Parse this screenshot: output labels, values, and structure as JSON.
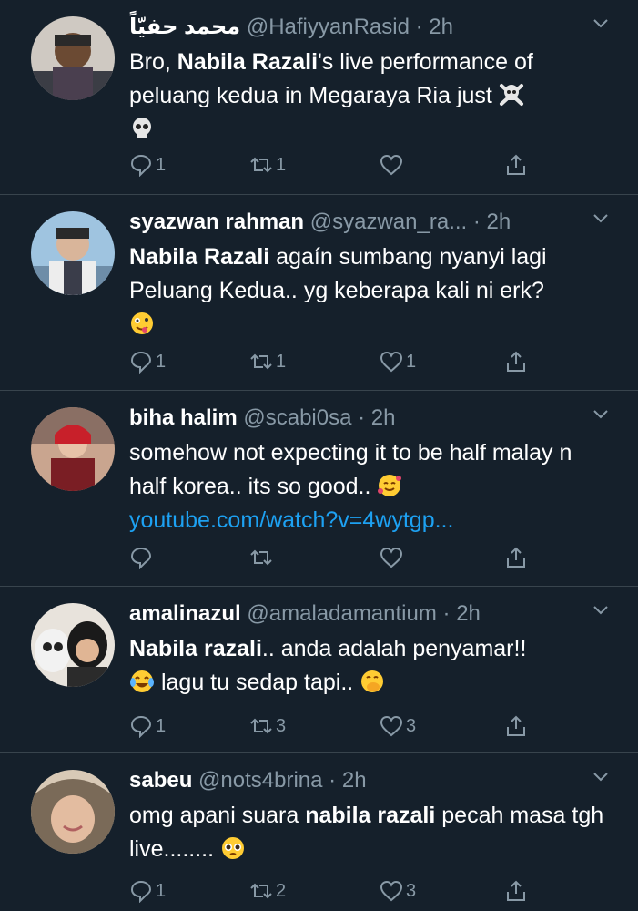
{
  "theme": {
    "background": "#15202b",
    "divider": "#38444d",
    "muted": "#8899a6",
    "link": "#1da1f2"
  },
  "tweets": [
    {
      "name": "محمد حفيّاً",
      "handle": "@HafiyyanRasid",
      "sep": "·",
      "time": "2h",
      "segments": [
        {
          "t": "Bro, ",
          "bold": false
        },
        {
          "t": "Nabila Razali",
          "bold": true
        },
        {
          "t": "'s live performance of peluang kedua in Megaraya Ria just ",
          "bold": false
        }
      ],
      "emojis": [
        "skull-crossbones-emoji",
        "skull-emoji"
      ],
      "replies": "1",
      "retweets": "1",
      "likes": ""
    },
    {
      "name": "syazwan rahman",
      "handle": "@syazwan_ra...",
      "sep": "·",
      "time": "2h",
      "segments": [
        {
          "t": "Nabila Razali",
          "bold": true
        },
        {
          "t": " agaín sumbang nyanyi lagi Peluang Kedua.. yg keberapa kali ni erk?",
          "bold": false
        }
      ],
      "emojis": [
        "zany-face-emoji"
      ],
      "replies": "1",
      "retweets": "1",
      "likes": "1"
    },
    {
      "name": "biha halim",
      "handle": "@scabi0sa",
      "sep": "·",
      "time": "2h",
      "segments": [
        {
          "t": "somehow not expecting it to be half malay n half korea.. its so good.. ",
          "bold": false
        }
      ],
      "emojis": [
        "smiling-face-with-hearts-emoji"
      ],
      "link": "youtube.com/watch?v=4wytgp...",
      "replies": "",
      "retweets": "",
      "likes": ""
    },
    {
      "name": "amalinazul",
      "handle": "@amaladamantium",
      "sep": "·",
      "time": "2h",
      "segments": [
        {
          "t": "Nabila razali",
          "bold": true
        },
        {
          "t": ".. anda adalah penyamar!!",
          "bold": false
        }
      ],
      "line2": "lagu tu sedap tapi..",
      "emojis": [
        "tears-of-joy-emoji",
        "hand-over-mouth-emoji"
      ],
      "replies": "1",
      "retweets": "3",
      "likes": "3"
    },
    {
      "name": "sabeu",
      "handle": "@nots4brina",
      "sep": "·",
      "time": "2h",
      "segments": [
        {
          "t": "omg apani suara ",
          "bold": false
        },
        {
          "t": "nabila razali",
          "bold": true
        },
        {
          "t": " pecah masa tgh live........ ",
          "bold": false
        }
      ],
      "emojis": [
        "pleading-face-emoji"
      ],
      "replies": "1",
      "retweets": "2",
      "likes": "3"
    }
  ]
}
